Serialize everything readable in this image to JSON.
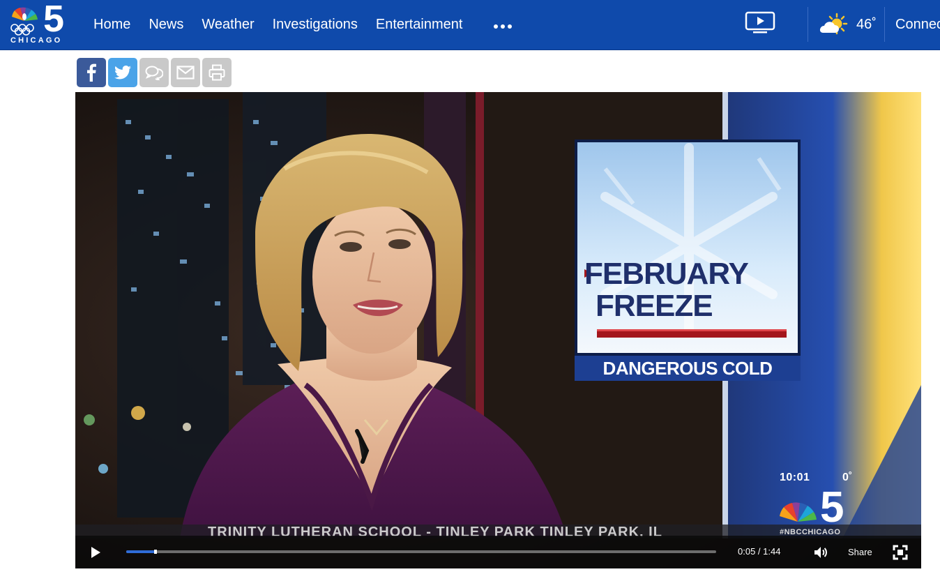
{
  "brand": {
    "logo_number": "5",
    "logo_city": "CHICAGO"
  },
  "nav": {
    "items": [
      "Home",
      "News",
      "Weather",
      "Investigations",
      "Entertainment"
    ],
    "more_icon": "ellipsis-icon"
  },
  "header": {
    "tv_icon": "tv-play-icon",
    "weather_icon": "partly-cloudy-icon",
    "temperature": "46˚",
    "connect_label": "Connect"
  },
  "share": {
    "buttons": [
      "facebook-icon",
      "twitter-icon",
      "comment-icon",
      "email-icon",
      "print-icon"
    ]
  },
  "video": {
    "graphic": {
      "line1": "FEBRUARY",
      "line2": "FREEZE",
      "subtitle": "DANGEROUS COLD"
    },
    "bug": {
      "time": "10:01",
      "temp": "0˚",
      "handle": "#NBCCHICAGO"
    },
    "ticker": "TRINITY LUTHERAN SCHOOL - TINLEY PARK    TINLEY PARK, IL",
    "player": {
      "current_time": "0:05",
      "duration": "1:44",
      "time_display": "0:05 / 1:44",
      "progress_fraction": 0.05,
      "share_label": "Share"
    }
  },
  "colors": {
    "header_bg": "#0f4aab",
    "facebook": "#3b5a9a",
    "twitter": "#4aa3e8",
    "share_gray": "#c9c9c9",
    "progress": "#2f6cd8"
  }
}
